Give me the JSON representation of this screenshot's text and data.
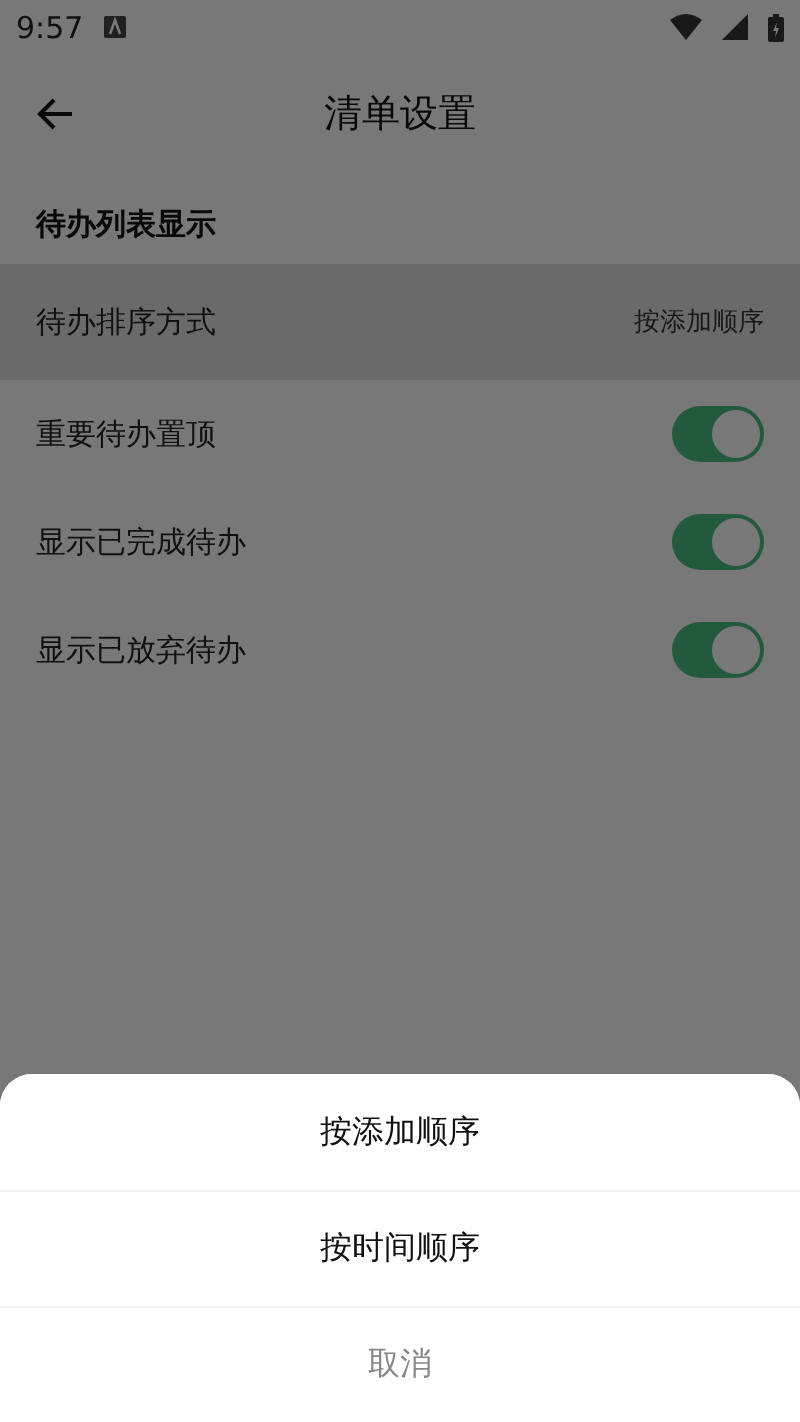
{
  "status_bar": {
    "time": "9:57"
  },
  "header": {
    "title": "清单设置"
  },
  "section": {
    "title": "待办列表显示"
  },
  "sort_row": {
    "label": "待办排序方式",
    "value": "按添加顺序",
    "selected": true
  },
  "toggles": [
    {
      "label": "重要待办置顶",
      "on": true
    },
    {
      "label": "显示已完成待办",
      "on": true
    },
    {
      "label": "显示已放弃待办",
      "on": true
    }
  ],
  "sheet": {
    "options": [
      {
        "label": "按添加顺序",
        "kind": "option"
      },
      {
        "label": "按时间顺序",
        "kind": "option"
      },
      {
        "label": "取消",
        "kind": "cancel"
      }
    ]
  }
}
